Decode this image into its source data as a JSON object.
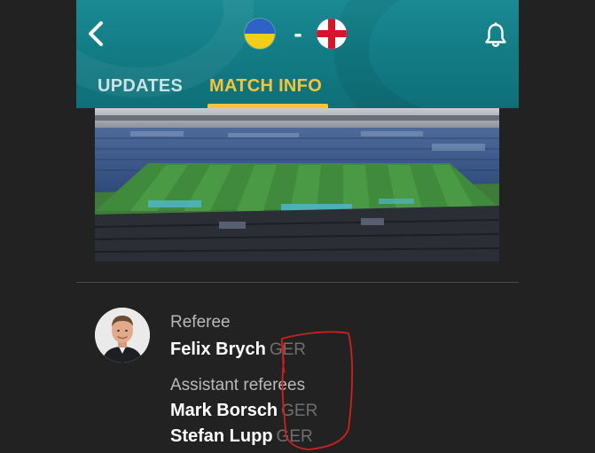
{
  "header": {
    "back_icon": "chevron-left-icon",
    "home_team_flag": "ukraine-flag-icon",
    "separator": "-",
    "away_team_flag": "england-flag-icon",
    "bell_icon": "bell-icon",
    "colors": {
      "accent": "#f4c53a",
      "header_bg": "#137d86",
      "inactive_tab": "#c7e4e6"
    }
  },
  "tabs": [
    {
      "label": "UPDATES",
      "active": false
    },
    {
      "label": "MATCH INFO",
      "active": true
    }
  ],
  "officials": {
    "referee_label": "Referee",
    "referee": {
      "name": "Felix Brych",
      "nationality": "GER"
    },
    "assistants_label": "Assistant referees",
    "assistants": [
      {
        "name": "Mark Borsch",
        "nationality": "GER"
      },
      {
        "name": "Stefan Lupp",
        "nationality": "GER"
      }
    ]
  },
  "annotation": {
    "color": "#d11f1f",
    "shape": "hand-drawn-loop"
  }
}
